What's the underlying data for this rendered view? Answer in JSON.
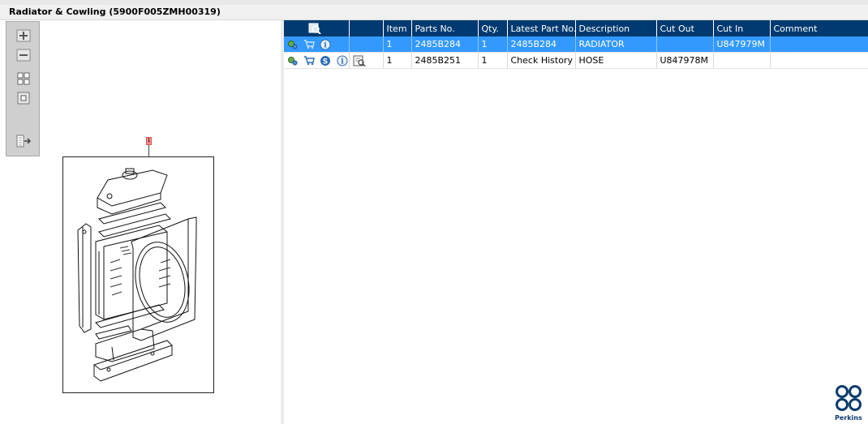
{
  "window": {
    "title": "Radiator & Cowling (5900F005ZMH00319)"
  },
  "diagram": {
    "callout_label": "1"
  },
  "table": {
    "columns": [
      "",
      "",
      "Item",
      "Parts No.",
      "Qty.",
      "Latest Part No.",
      "Description",
      "Cut Out",
      "Cut In",
      "Comment"
    ],
    "rows": [
      {
        "item": "1",
        "parts_no": "2485B284",
        "qty": "1",
        "latest_part_no": "2485B284",
        "description": "RADIATOR",
        "cut_out": "",
        "cut_in": "U847979M",
        "comment": "",
        "selected": true
      },
      {
        "item": "1",
        "parts_no": "2485B251",
        "qty": "1",
        "latest_part_no": "Check History",
        "description": "HOSE",
        "cut_out": "U847978M",
        "cut_in": "",
        "comment": "",
        "selected": false
      }
    ]
  },
  "icons": {
    "toolbar": [
      "zoom-in-icon",
      "zoom-out-icon",
      "fit-all-icon",
      "fit-window-icon",
      "export-list-icon"
    ],
    "row": [
      "gear-icon",
      "cart-icon",
      "supersession-icon",
      "info-icon",
      "history-icon"
    ]
  },
  "brand": {
    "name": "Perkins",
    "color": "#0b3a6e"
  },
  "colors": {
    "header": "#003a70",
    "selected_row": "#3399ff"
  }
}
